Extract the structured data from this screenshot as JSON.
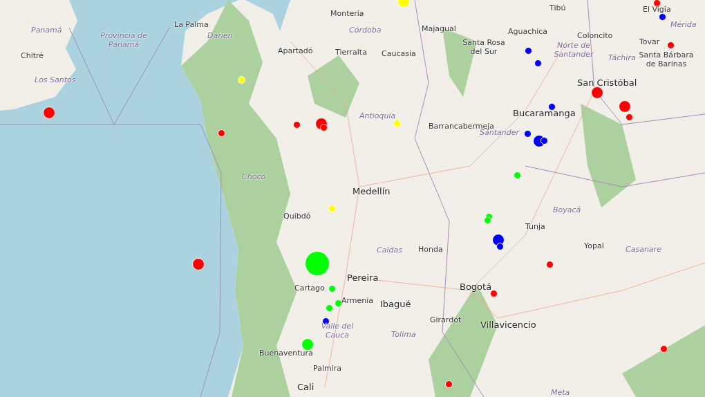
{
  "map": {
    "labels": [
      {
        "text": "Panamá",
        "kind": "region"
      },
      {
        "text": "Provincia de Panamá",
        "kind": "region"
      },
      {
        "text": "La Palma",
        "kind": "city"
      },
      {
        "text": "Chitré",
        "kind": "city"
      },
      {
        "text": "Los Santos",
        "kind": "region"
      },
      {
        "text": "Darién",
        "kind": "region"
      },
      {
        "text": "Montería",
        "kind": "city"
      },
      {
        "text": "Córdoba",
        "kind": "region"
      },
      {
        "text": "Majagual",
        "kind": "city"
      },
      {
        "text": "Apartadó",
        "kind": "city"
      },
      {
        "text": "Tierralta",
        "kind": "city"
      },
      {
        "text": "Caucasia",
        "kind": "city"
      },
      {
        "text": "Santa Rosa del Sur",
        "kind": "city"
      },
      {
        "text": "Aguachica",
        "kind": "city"
      },
      {
        "text": "Tibú",
        "kind": "city"
      },
      {
        "text": "El Vigía",
        "kind": "city"
      },
      {
        "text": "Mérida",
        "kind": "region"
      },
      {
        "text": "Norte de Santander",
        "kind": "region"
      },
      {
        "text": "Coloncito",
        "kind": "city"
      },
      {
        "text": "Tovar",
        "kind": "city"
      },
      {
        "text": "Táchira",
        "kind": "region"
      },
      {
        "text": "San Cristóbal",
        "kind": "bigcity"
      },
      {
        "text": "Santa Bárbara de Barinas",
        "kind": "city"
      },
      {
        "text": "Antioquia",
        "kind": "region"
      },
      {
        "text": "Bucaramanga",
        "kind": "bigcity"
      },
      {
        "text": "Barrancabermeja",
        "kind": "city"
      },
      {
        "text": "Santander",
        "kind": "region"
      },
      {
        "text": "Chocó",
        "kind": "region"
      },
      {
        "text": "Medellín",
        "kind": "bigcity"
      },
      {
        "text": "Quibdó",
        "kind": "city"
      },
      {
        "text": "Boyacá",
        "kind": "region"
      },
      {
        "text": "Tunja",
        "kind": "city"
      },
      {
        "text": "Caldas",
        "kind": "region"
      },
      {
        "text": "Honda",
        "kind": "city"
      },
      {
        "text": "Yopal",
        "kind": "city"
      },
      {
        "text": "Casanare",
        "kind": "region"
      },
      {
        "text": "Pereira",
        "kind": "bigcity"
      },
      {
        "text": "Cartago",
        "kind": "city"
      },
      {
        "text": "Armenia",
        "kind": "city"
      },
      {
        "text": "Ibagué",
        "kind": "bigcity"
      },
      {
        "text": "Bogotá",
        "kind": "bigcity"
      },
      {
        "text": "Villavicencio",
        "kind": "bigcity"
      },
      {
        "text": "Girardot",
        "kind": "city"
      },
      {
        "text": "Tolima",
        "kind": "region"
      },
      {
        "text": "Valle del Cauca",
        "kind": "region"
      },
      {
        "text": "Buenaventura",
        "kind": "city"
      },
      {
        "text": "Palmira",
        "kind": "city"
      },
      {
        "text": "Cali",
        "kind": "bigcity"
      },
      {
        "text": "Meta",
        "kind": "region"
      }
    ],
    "markers": [
      {
        "color": "#ffff00",
        "kind": "medium"
      },
      {
        "color": "#ff0000",
        "kind": "small"
      },
      {
        "color": "#0000ff",
        "kind": "small"
      },
      {
        "color": "#ff0000",
        "kind": "small"
      },
      {
        "color": "#0000ff",
        "kind": "small"
      },
      {
        "color": "#0000ff",
        "kind": "small"
      },
      {
        "color": "#ff0000",
        "kind": "medium"
      },
      {
        "color": "#ff0000",
        "kind": "medium"
      },
      {
        "color": "#ff0000",
        "kind": "small"
      },
      {
        "color": "#0000ff",
        "kind": "small"
      },
      {
        "color": "#0000ff",
        "kind": "small"
      },
      {
        "color": "#0000ff",
        "kind": "medium"
      },
      {
        "color": "#0000ff",
        "kind": "small"
      },
      {
        "color": "#ff0000",
        "kind": "medium"
      },
      {
        "color": "#ffff00",
        "kind": "small"
      },
      {
        "color": "#ff0000",
        "kind": "small"
      },
      {
        "color": "#ff0000",
        "kind": "small"
      },
      {
        "color": "#ff0000",
        "kind": "medium"
      },
      {
        "color": "#ff0000",
        "kind": "small"
      },
      {
        "color": "#ffff00",
        "kind": "small"
      },
      {
        "color": "#00ff00",
        "kind": "small"
      },
      {
        "color": "#ffff00",
        "kind": "small"
      },
      {
        "color": "#00ff00",
        "kind": "small"
      },
      {
        "color": "#00ff00",
        "kind": "small"
      },
      {
        "color": "#0000ff",
        "kind": "medium"
      },
      {
        "color": "#0000ff",
        "kind": "small"
      },
      {
        "color": "#00ff00",
        "kind": "large"
      },
      {
        "color": "#ff0000",
        "kind": "medium"
      },
      {
        "color": "#ff0000",
        "kind": "small"
      },
      {
        "color": "#00ff00",
        "kind": "small"
      },
      {
        "color": "#00ff00",
        "kind": "small"
      },
      {
        "color": "#00ff00",
        "kind": "small"
      },
      {
        "color": "#0000ff",
        "kind": "small"
      },
      {
        "color": "#ff0000",
        "kind": "small"
      },
      {
        "color": "#00ff00",
        "kind": "medium"
      },
      {
        "color": "#ff0000",
        "kind": "small"
      },
      {
        "color": "#ff0000",
        "kind": "small"
      }
    ]
  }
}
